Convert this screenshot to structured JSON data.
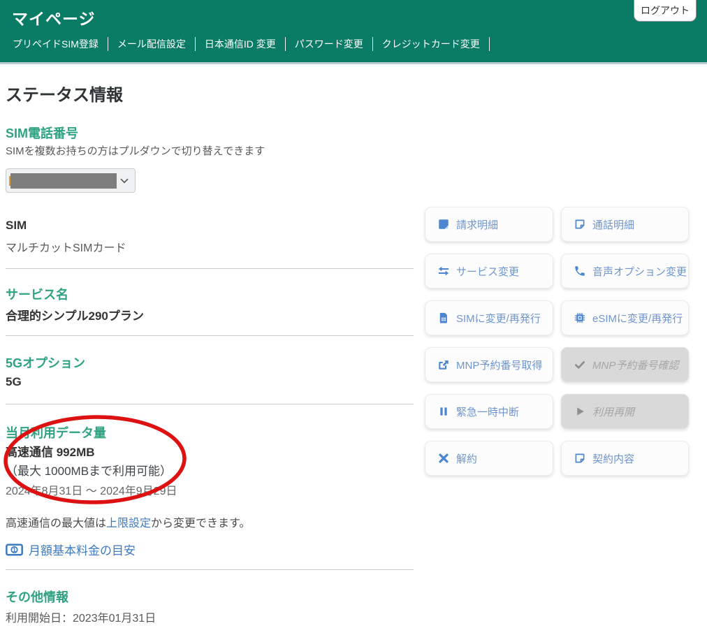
{
  "colors": {
    "header_background": "#0a7b64",
    "heading_green": "#2fa381",
    "link_blue": "#3d7ac0",
    "button_blue": "#6e95ce",
    "button_icon_blue": "#4d85cf",
    "disabled_background": "#d9d9d9",
    "annotation_red": "#dd1111"
  },
  "header": {
    "title": "マイページ",
    "logout_label": "ログアウト",
    "nav": [
      {
        "label": "プリペイドSIM登録"
      },
      {
        "label": "メール配信設定"
      },
      {
        "label": "日本通信ID 変更"
      },
      {
        "label": "パスワード変更"
      },
      {
        "label": "クレジットカード変更"
      }
    ]
  },
  "page_title": "ステータス情報",
  "sim_phone": {
    "heading": "SIM電話番号",
    "description": "SIMを複数お持ちの方はプルダウンで切り替えできます"
  },
  "sim": {
    "label": "SIM",
    "value": "マルチカットSIMカード"
  },
  "service": {
    "heading": "サービス名",
    "value": "合理的シンプル290プラン"
  },
  "option_5g": {
    "heading": "5Gオプション",
    "value": "5G"
  },
  "data_usage": {
    "heading": "当月利用データ量",
    "usage": "高速通信 992MB",
    "limit_note": "（最大 1000MBまで利用可能）",
    "period": "2024年8月31日 ～ 2024年9月29日"
  },
  "limit_setting": {
    "text_before": "高速通信の最大値は",
    "link_label": "上限設定",
    "text_after": "から変更できます。"
  },
  "fee_link_label": "月額基本料金の目安",
  "other_info": {
    "heading": "その他情報",
    "start_date": "利用開始日：2023年01月31日"
  },
  "buttons": [
    {
      "label": "請求明細",
      "icon": "billing-note-icon",
      "disabled": false
    },
    {
      "label": "通話明細",
      "icon": "call-note-icon",
      "disabled": false
    },
    {
      "label": "サービス変更",
      "icon": "exchange-icon",
      "disabled": false
    },
    {
      "label": "音声オプション変更",
      "icon": "phone-icon",
      "disabled": false
    },
    {
      "label": "SIMに変更/再発行",
      "icon": "sim-card-icon",
      "disabled": false
    },
    {
      "label": "eSIMに変更/再発行",
      "icon": "chip-icon",
      "disabled": false
    },
    {
      "label": "MNP予約番号取得",
      "icon": "share-icon",
      "disabled": false
    },
    {
      "label": "MNP予約番号確認",
      "icon": "check-icon",
      "disabled": true
    },
    {
      "label": "緊急一時中断",
      "icon": "pause-icon",
      "disabled": false
    },
    {
      "label": "利用再開",
      "icon": "play-icon",
      "disabled": true
    },
    {
      "label": "解約",
      "icon": "close-icon",
      "disabled": false
    },
    {
      "label": "契約内容",
      "icon": "contract-note-icon",
      "disabled": false
    }
  ]
}
